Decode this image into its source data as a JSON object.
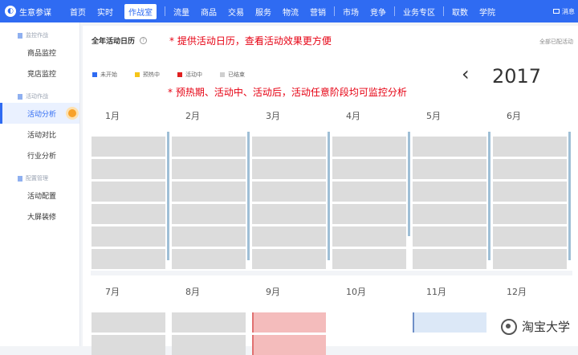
{
  "topnav": {
    "logo_text": "生意参谋",
    "items": [
      {
        "label": "首页"
      },
      {
        "label": "实时"
      },
      {
        "label": "作战室",
        "active": true
      },
      {
        "label": "流量"
      },
      {
        "label": "商品"
      },
      {
        "label": "交易"
      },
      {
        "label": "服务"
      },
      {
        "label": "物流"
      },
      {
        "label": "营销"
      },
      {
        "label": "市场"
      },
      {
        "label": "竞争"
      },
      {
        "label": "业务专区"
      },
      {
        "label": "取数"
      },
      {
        "label": "学院"
      }
    ],
    "message_label": "消息"
  },
  "sidebar": {
    "groups": [
      {
        "label": "监控作战",
        "items": [
          {
            "label": "商品监控"
          },
          {
            "label": "竞店监控"
          }
        ]
      },
      {
        "label": "活动作战",
        "items": [
          {
            "label": "活动分析",
            "active": true
          },
          {
            "label": "活动对比"
          },
          {
            "label": "行业分析"
          }
        ]
      },
      {
        "label": "配置管理",
        "items": [
          {
            "label": "活动配置"
          },
          {
            "label": "大屏装修"
          }
        ]
      }
    ]
  },
  "main": {
    "title": "全年活动日历",
    "annotation_top": "* 提供活动日历，查看活动效果更方便",
    "filter_label": "全部已配活动",
    "legend": [
      {
        "label": "未开始",
        "color": "#2f6bf2"
      },
      {
        "label": "预热中",
        "color": "#f5c518"
      },
      {
        "label": "活动中",
        "color": "#e02020"
      },
      {
        "label": "已结束",
        "color": "#cfcfcf"
      }
    ],
    "prev_arrow": "‹",
    "year": "2017",
    "annotation_mid": "* 预热期、活动中、活动后，活动任意阶段均可监控分析",
    "months": [
      "1月",
      "2月",
      "3月",
      "4月",
      "5月",
      "6月",
      "7月",
      "8月",
      "9月",
      "10月",
      "11月",
      "12月"
    ]
  },
  "watermark": "淘宝大学",
  "colors": {
    "brand": "#2f6bf2",
    "annotation": "#e60012",
    "bar_ended": "#dcdcdc",
    "bar_active": "#f4bcbc",
    "bar_upcoming": "#dce8f7"
  }
}
